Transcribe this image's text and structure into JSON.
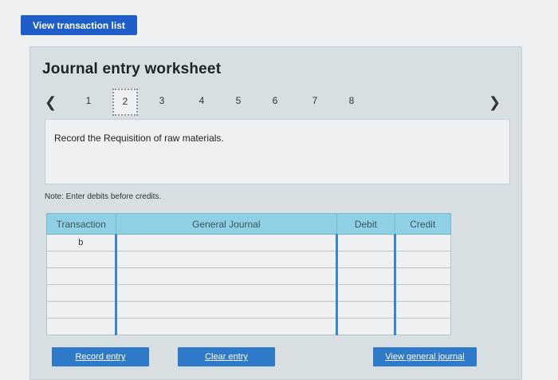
{
  "top_button": {
    "label": "View transaction list"
  },
  "worksheet": {
    "title": "Journal entry worksheet",
    "pager": {
      "prev_icon": "chevron-left-icon",
      "next_icon": "chevron-right-icon",
      "pages": [
        "1",
        "2",
        "3",
        "4",
        "5",
        "6",
        "7",
        "8"
      ],
      "active_page": "2"
    },
    "prompt": "Record the Requisition of raw materials.",
    "note": "Note: Enter debits before credits.",
    "table": {
      "headers": [
        "Transaction",
        "General Journal",
        "Debit",
        "Credit"
      ],
      "rows": [
        [
          "b",
          "",
          "",
          ""
        ],
        [
          "",
          "",
          "",
          ""
        ],
        [
          "",
          "",
          "",
          ""
        ],
        [
          "",
          "",
          "",
          ""
        ],
        [
          "",
          "",
          "",
          ""
        ],
        [
          "",
          "",
          "",
          ""
        ]
      ]
    },
    "buttons": {
      "record": "Record entry",
      "clear": "Clear entry",
      "view": "View general journal"
    }
  },
  "colors": {
    "primary_button": "#1f5ec9",
    "action_button": "#2f79c9",
    "header_fill": "#8fd0e4",
    "panel_bg": "#d8dfe3"
  }
}
